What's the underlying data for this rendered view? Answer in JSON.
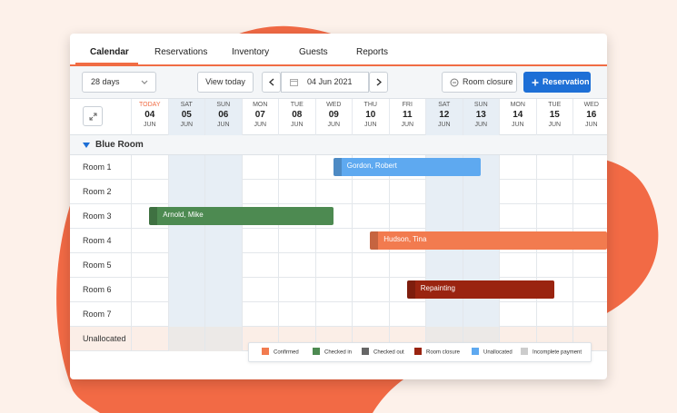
{
  "tabs": [
    {
      "label": "Calendar",
      "active": true
    },
    {
      "label": "Reservations"
    },
    {
      "label": "Inventory"
    },
    {
      "label": "Guests"
    },
    {
      "label": "Reports"
    }
  ],
  "toolbar": {
    "range_select": "28 days",
    "view_today": "View today",
    "date": "04 Jun 2021",
    "room_closure": "Room closure",
    "reservation": "Reservation"
  },
  "dates": [
    {
      "dow": "TODAY",
      "day": "04",
      "mon": "JUN",
      "today": true
    },
    {
      "dow": "SAT",
      "day": "05",
      "mon": "JUN",
      "weekend": true
    },
    {
      "dow": "SUN",
      "day": "06",
      "mon": "JUN",
      "weekend": true
    },
    {
      "dow": "MON",
      "day": "07",
      "mon": "JUN"
    },
    {
      "dow": "TUE",
      "day": "08",
      "mon": "JUN"
    },
    {
      "dow": "WED",
      "day": "09",
      "mon": "JUN"
    },
    {
      "dow": "THU",
      "day": "10",
      "mon": "JUN"
    },
    {
      "dow": "FRI",
      "day": "11",
      "mon": "JUN"
    },
    {
      "dow": "SAT",
      "day": "12",
      "mon": "JUN",
      "weekend": true
    },
    {
      "dow": "SUN",
      "day": "13",
      "mon": "JUN",
      "weekend": true
    },
    {
      "dow": "MON",
      "day": "14",
      "mon": "JUN"
    },
    {
      "dow": "TUE",
      "day": "15",
      "mon": "JUN"
    },
    {
      "dow": "WED",
      "day": "16",
      "mon": "JUN"
    }
  ],
  "group": "Blue Room",
  "rooms": [
    "Room 1",
    "Room 2",
    "Room 3",
    "Room 4",
    "Room 5",
    "Room 6",
    "Room 7",
    "Unallocated"
  ],
  "bookings": [
    {
      "name": "Gordon, Robert",
      "room": 0,
      "status": "Unallocated",
      "start_day": "09",
      "end_day": "13"
    },
    {
      "name": "Arnold, Mike",
      "room": 2,
      "status": "Checked in",
      "start_day": "04",
      "end_day": "09"
    },
    {
      "name": "Hudson, Tina",
      "room": 3,
      "status": "Confirmed",
      "start_day": "10",
      "end_day": "16"
    },
    {
      "name": "Repainting",
      "room": 5,
      "status": "Room closure",
      "start_day": "11",
      "end_day": "15"
    }
  ],
  "legend": [
    {
      "label": "Confirmed",
      "color": "#f27b4f"
    },
    {
      "label": "Checked in",
      "color": "#4d8a51"
    },
    {
      "label": "Checked out",
      "color": "#666666"
    },
    {
      "label": "Room closure",
      "color": "#9a2410"
    },
    {
      "label": "Unallocated",
      "color": "#5ea9f0"
    },
    {
      "label": "Incomplete payment",
      "color": "#cccccc"
    }
  ],
  "colors": {
    "accent": "#f06c44",
    "primary": "#1d6fd6"
  }
}
